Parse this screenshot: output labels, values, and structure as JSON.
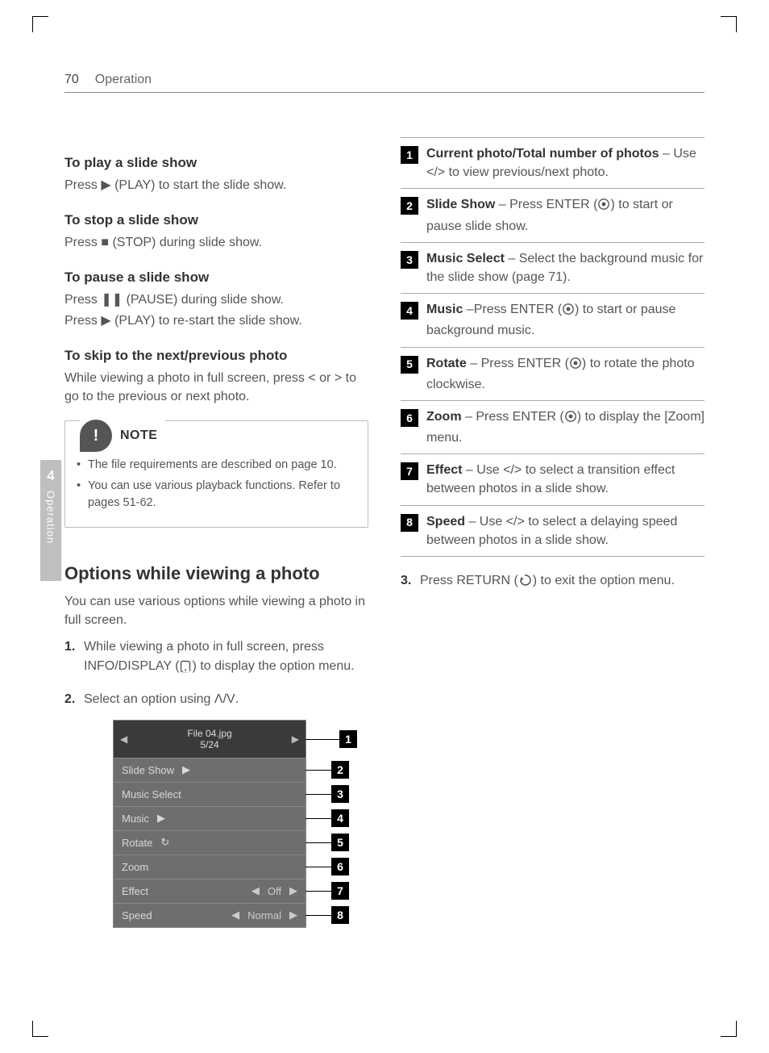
{
  "page": {
    "number": "70",
    "section": "Operation"
  },
  "side_tab": {
    "num": "4",
    "text": "Operation"
  },
  "left": {
    "play_h": "To play a slide show",
    "play_t": "Press ▶ (PLAY) to start the slide show.",
    "stop_h": "To stop a slide show",
    "stop_t": "Press ■ (STOP) during slide show.",
    "pause_h": "To pause a slide show",
    "pause_t1": "Press ❚❚ (PAUSE) during slide show.",
    "pause_t2": "Press ▶ (PLAY) to re-start the slide show.",
    "skip_h": "To skip to the next/previous photo",
    "skip_t": "While viewing a photo in full screen, press < or > to go to the previous or next photo.",
    "note_label": "NOTE",
    "note_items": [
      "The file requirements are described on page 10.",
      "You can use various playback functions. Refer to pages 51-62."
    ],
    "options_h": "Options while viewing a photo",
    "options_intro": "You can use various options while viewing a photo in full screen.",
    "step1": "While viewing a photo in full screen, press INFO/DISPLAY (",
    "step1_tail": ") to display the option menu.",
    "step2": "Select an option using ",
    "step2_tail": "."
  },
  "menu": {
    "file": "File 04.jpg",
    "count": "5/24",
    "rows": [
      {
        "label": "Slide Show",
        "icon": "▶",
        "badge": "2"
      },
      {
        "label": "Music Select",
        "icon": "",
        "badge": "3"
      },
      {
        "label": "Music",
        "icon": "▶",
        "badge": "4"
      },
      {
        "label": "Rotate",
        "icon": "↻",
        "badge": "5"
      },
      {
        "label": "Zoom",
        "icon": "",
        "badge": "6"
      },
      {
        "label": "Effect",
        "value": "Off",
        "arrows": true,
        "badge": "7"
      },
      {
        "label": "Speed",
        "value": "Normal",
        "arrows": true,
        "badge": "8"
      }
    ],
    "header_badge": "1"
  },
  "right": {
    "items": [
      {
        "n": "1",
        "bold": "Current photo/Total number of photos",
        "rest": " – Use </> to view previous/next photo."
      },
      {
        "n": "2",
        "bold": "Slide Show",
        "rest": " – Press ENTER (",
        "tail": ") to start or pause slide show."
      },
      {
        "n": "3",
        "bold": "Music Select",
        "rest": " – Select the background music for the slide show (page 71)."
      },
      {
        "n": "4",
        "bold": "Music",
        "rest": " –Press ENTER (",
        "tail": ") to start or pause background music."
      },
      {
        "n": "5",
        "bold": "Rotate",
        "rest": " – Press ENTER (",
        "tail": ") to rotate the photo clockwise."
      },
      {
        "n": "6",
        "bold": "Zoom",
        "rest": " – Press ENTER (",
        "tail": ") to display the [Zoom] menu."
      },
      {
        "n": "7",
        "bold": "Effect",
        "rest": " – Use </> to select a transition effect between photos in a slide show."
      },
      {
        "n": "8",
        "bold": "Speed",
        "rest": " – Use </> to select a delaying speed between photos in a slide show."
      }
    ],
    "step3_pre": "Press RETURN (",
    "step3_post": ") to exit the option menu.",
    "step3_num": "3."
  }
}
